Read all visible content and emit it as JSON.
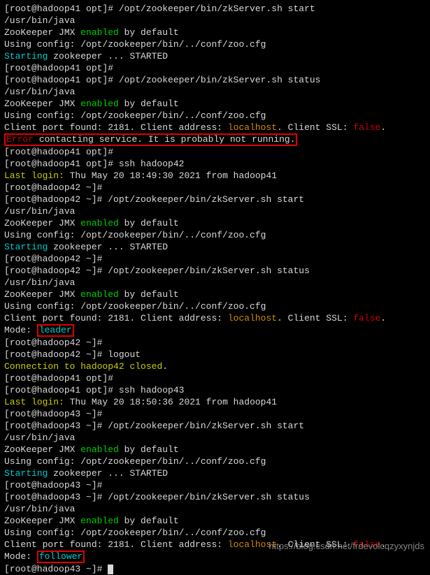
{
  "prompt_h41": "[root@hadoop41 opt]# ",
  "prompt_h42": "[root@hadoop42 ~]# ",
  "prompt_h43": "[root@hadoop43 ~]# ",
  "cmd_start": "/opt/zookeeper/bin/zkServer.sh start",
  "cmd_status": "/opt/zookeeper/bin/zkServer.sh status",
  "cmd_ssh42": "ssh hadoop42",
  "cmd_ssh43": "ssh hadoop43",
  "cmd_logout": "logout",
  "java_path": "/usr/bin/java",
  "jmx_pre": "ZooKeeper JMX ",
  "enabled": "enabled",
  "jmx_post": " by default",
  "config_line": "Using config: /opt/zookeeper/bin/../conf/zoo.cfg",
  "starting": "Starting",
  "starting_post": " zookeeper ... STARTED",
  "client_port_pre": "Client port found: 2181. Client address: ",
  "localhost": "localhost",
  "client_ssl_pre": ". Client SSL: ",
  "false": "false",
  "dot": ".",
  "error": "Error",
  "error_msg": " contacting service. It is probably not running.",
  "last_login": "Last login:",
  "login_42": " Thu May 20 18:49:30 2021 from hadoop41",
  "login_43": " Thu May 20 18:50:36 2021 from hadoop41",
  "mode_pre": "Mode: ",
  "leader": "leader",
  "follower": "follower",
  "conn_closed_pre": "Connection to hadoop42 ",
  "closed": "closed",
  "watermark": "https://blog.csdn.net/frdevolcqzyxynjds"
}
